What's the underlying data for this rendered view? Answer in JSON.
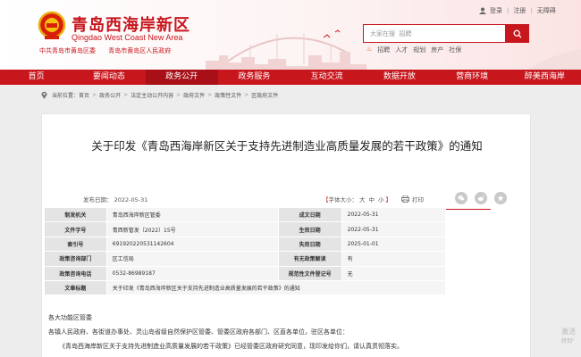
{
  "header": {
    "site_name": "青岛西海岸新区",
    "site_name_en": "Qingdao West Coast New Area",
    "org_left": "中共青岛市黄岛区委",
    "org_right": "青岛市黄岛区人民政府",
    "top_links": {
      "login": "登录",
      "register": "注册",
      "accessibility": "无障碍"
    },
    "search": {
      "placeholder": "大家在搜  招聘"
    },
    "hot_words": [
      "招聘",
      "人才",
      "规划",
      "房产",
      "社保"
    ],
    "accent": "#c8161d"
  },
  "nav": {
    "items": [
      {
        "label": "首页"
      },
      {
        "label": "要闻动态"
      },
      {
        "label": "政务公开"
      },
      {
        "label": "政务服务"
      },
      {
        "label": "互动交流"
      },
      {
        "label": "数据开放"
      },
      {
        "label": "营商环境"
      },
      {
        "label": "醉美西海岸"
      }
    ],
    "active_index": 2
  },
  "breadcrumb": {
    "label": "当前位置：",
    "items": [
      "首页",
      "政务公开",
      "法定主动公开内容",
      "政府文件",
      "政策性文件",
      "区政府文件"
    ]
  },
  "article": {
    "title": "关于印发《青岛西海岸新区关于支持先进制造业高质量发展的若干政策》的通知",
    "publish_date": "发布日期：  2022-05-31",
    "font_size": {
      "bracket_open": "【",
      "label": "字体大小：",
      "large": "大",
      "medium": "中",
      "small": "小",
      "bracket_close": "】"
    },
    "print_label": "打印",
    "share_icons": [
      "wechat-icon",
      "weibo-icon",
      "star-icon"
    ],
    "meta_table": [
      {
        "l1": "制发机关",
        "v1": "青岛西海岸新区管委",
        "l2": "成文日期",
        "v2": "2022-05-31"
      },
      {
        "l1": "文件字号",
        "v1": "青西新管发〔2022〕15号",
        "l2": "生效日期",
        "v2": "2022-05-31"
      },
      {
        "l1": "索引号",
        "v1": "69192022053114260​4",
        "l2": "失效日期",
        "v2": "2025-01-01"
      },
      {
        "l1": "政策咨询部门",
        "v1": "区工信局",
        "l2": "有无政策解读",
        "v2": "有"
      },
      {
        "l1": "政策咨询电话",
        "v1": "0532-86989187",
        "l2": "规范性文件登记号",
        "v2": "无"
      }
    ],
    "doc_name_label": "文章标题",
    "doc_name_value": "关于印发《青岛西海岸新区关于支持先进制造业高质量发展的若干政策》的通知",
    "body": {
      "salutation": "各大功能区管委",
      "line1": "各镇人民政府、各街道办事处、灵山岛省级自然保护区管委、管委区政府各部门、区直各单位，驻区各单位：",
      "line2": "《青岛西海岸新区关于支持先进制造业高质量发展的若干政策》已经管委区政府研究同意，现印发给你们，请认真贯彻落实。"
    }
  },
  "watermark": {
    "line1": "激活",
    "line2": "转到\""
  }
}
